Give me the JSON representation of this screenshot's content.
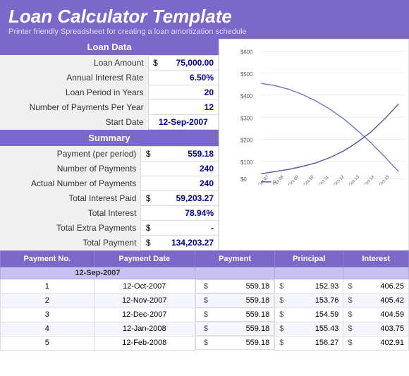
{
  "header": {
    "title": "Loan Calculator Template",
    "subtitle": "Printer friendly Spreadsheet for creating a loan amortization schedule"
  },
  "loan_data": {
    "section_title": "Loan Data",
    "rows": [
      {
        "label": "Loan Amount",
        "dollar": "$",
        "value": "75,000.00",
        "type": "amount"
      },
      {
        "label": "Annual Interest Rate",
        "value": "6.50%",
        "type": "pct"
      },
      {
        "label": "Loan Period in Years",
        "value": "20",
        "type": "num"
      },
      {
        "label": "Number of Payments Per Year",
        "value": "12",
        "type": "num"
      },
      {
        "label": "Start Date",
        "value": "12-Sep-2007",
        "type": "date"
      }
    ]
  },
  "summary": {
    "section_title": "Summary",
    "rows": [
      {
        "label": "Payment (per period)",
        "dollar": "$",
        "value": "559.18",
        "type": "amount"
      },
      {
        "label": "Number of Payments",
        "value": "240",
        "type": "num"
      },
      {
        "label": "Actual Number of Payments",
        "value": "240",
        "type": "num"
      },
      {
        "label": "Total Interest Paid",
        "dollar": "$",
        "value": "59,203.27",
        "type": "amount"
      },
      {
        "label": "Total Interest",
        "value": "78.94%",
        "type": "pct"
      },
      {
        "label": "Total Extra Payments",
        "dollar": "$",
        "value": "-",
        "type": "amount"
      },
      {
        "label": "Total Payment",
        "dollar": "$",
        "value": "134,203.27",
        "type": "amount"
      }
    ]
  },
  "chart": {
    "y_labels": [
      "$600",
      "$500",
      "$400",
      "$300",
      "$200",
      "$100",
      "$0"
    ],
    "x_labels": [
      "Oct-07",
      "Oct-08",
      "Oct-09",
      "Oct-10",
      "Oct-11",
      "Oct-12",
      "Oct-13",
      "Oct-14",
      "Oct-15"
    ],
    "legend": "P..."
  },
  "payments_table": {
    "columns": [
      "Payment No.",
      "Payment Date",
      "Payment",
      "Principal",
      "Interest"
    ],
    "sub_header_date": "12-Sep-2007",
    "rows": [
      {
        "no": "1",
        "date": "12-Oct-2007",
        "payment_d": "$",
        "payment": "559.18",
        "principal_d": "$",
        "principal": "152.93",
        "interest_d": "$",
        "interest": "406.25"
      },
      {
        "no": "2",
        "date": "12-Nov-2007",
        "payment_d": "$",
        "payment": "559.18",
        "principal_d": "$",
        "principal": "153.76",
        "interest_d": "$",
        "interest": "405.42"
      },
      {
        "no": "3",
        "date": "12-Dec-2007",
        "payment_d": "$",
        "payment": "559.18",
        "principal_d": "$",
        "principal": "154.59",
        "interest_d": "$",
        "interest": "404.59"
      },
      {
        "no": "4",
        "date": "12-Jan-2008",
        "payment_d": "$",
        "payment": "559.18",
        "principal_d": "$",
        "principal": "155.43",
        "interest_d": "$",
        "interest": "403.75"
      },
      {
        "no": "5",
        "date": "12-Feb-2008",
        "payment_d": "$",
        "payment": "559.18",
        "principal_d": "$",
        "principal": "156.27",
        "interest_d": "$",
        "interest": "402.91"
      }
    ]
  }
}
